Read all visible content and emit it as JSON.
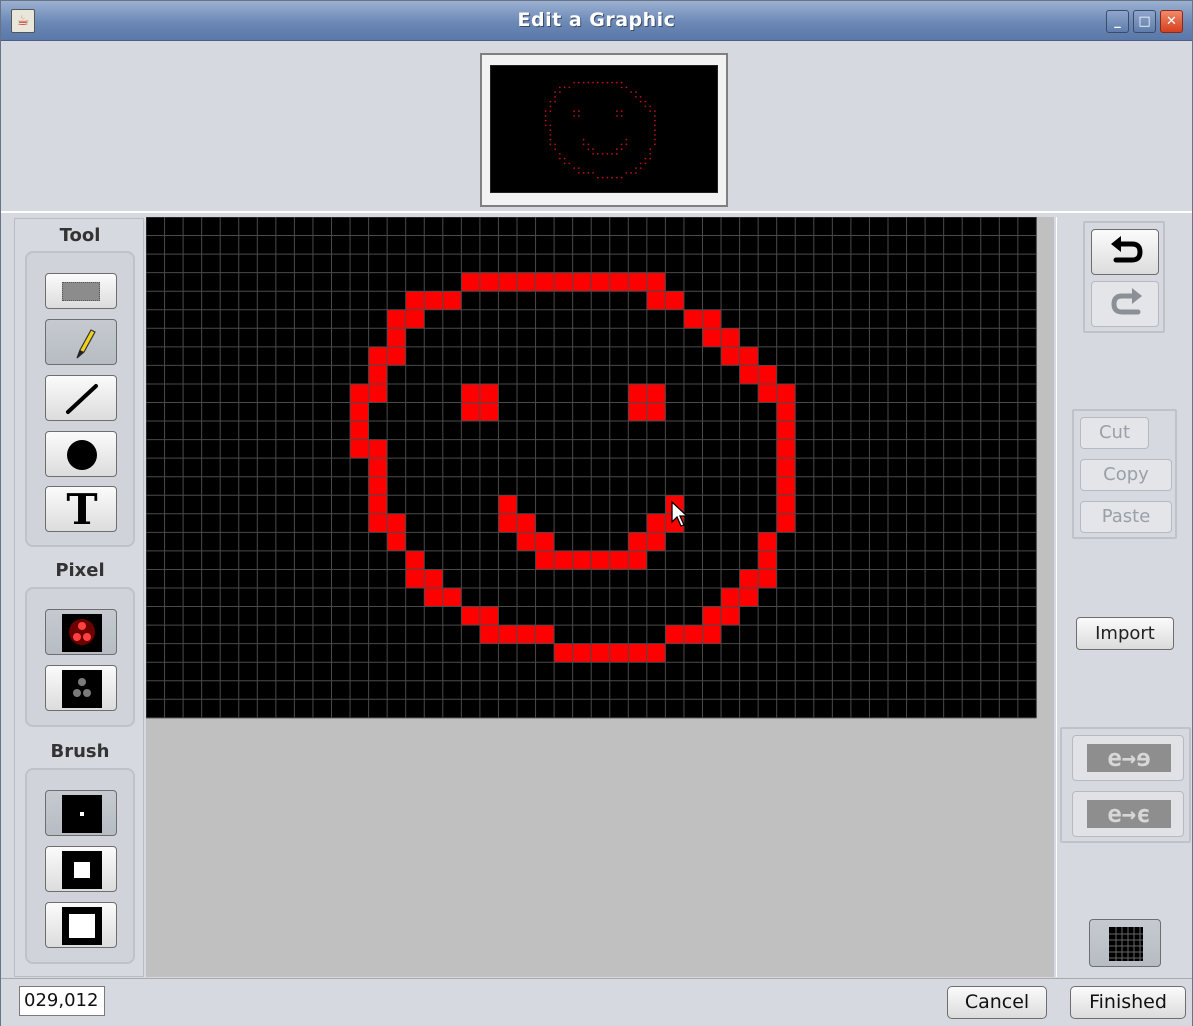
{
  "window": {
    "title": "Edit a Graphic",
    "controls": [
      "minimize",
      "maximize",
      "close"
    ]
  },
  "tool_panel": {
    "tool_label": "Tool",
    "tools": [
      {
        "name": "select",
        "icon": "marquee-select-icon",
        "selected": false
      },
      {
        "name": "pencil",
        "icon": "pencil-icon",
        "selected": true
      },
      {
        "name": "line",
        "icon": "line-icon",
        "selected": false
      },
      {
        "name": "circle",
        "icon": "filled-circle-icon",
        "selected": false
      },
      {
        "name": "text",
        "icon": "text-icon",
        "glyph": "T",
        "selected": false
      }
    ],
    "pixel_label": "Pixel",
    "pixels": [
      {
        "name": "red-pixel",
        "icon": "red-led-icon",
        "selected": true
      },
      {
        "name": "off-pixel",
        "icon": "dark-led-icon",
        "selected": false
      }
    ],
    "brush_label": "Brush",
    "brushes": [
      {
        "name": "small",
        "icon": "brush-small-icon",
        "selected": true
      },
      {
        "name": "medium",
        "icon": "brush-medium-icon",
        "selected": false
      },
      {
        "name": "large",
        "icon": "brush-large-icon",
        "selected": false
      }
    ]
  },
  "canvas": {
    "columns": 48,
    "rows": 27,
    "pixel_color": "#ff0000",
    "off_color": "#000000",
    "grid_color": "#4a4a4a",
    "lit_rows": [
      [
        3,
        [
          17,
          18,
          19,
          20,
          21,
          22,
          23,
          24,
          25,
          26,
          27
        ]
      ],
      [
        4,
        [
          14,
          15,
          16,
          27,
          28
        ]
      ],
      [
        5,
        [
          13,
          14,
          29,
          30
        ]
      ],
      [
        6,
        [
          13,
          30,
          31
        ]
      ],
      [
        7,
        [
          12,
          13,
          31,
          32
        ]
      ],
      [
        8,
        [
          12,
          32,
          33
        ]
      ],
      [
        9,
        [
          11,
          12,
          17,
          18,
          26,
          27,
          33,
          34
        ]
      ],
      [
        10,
        [
          11,
          17,
          18,
          26,
          27,
          34
        ]
      ],
      [
        11,
        [
          11,
          34
        ]
      ],
      [
        12,
        [
          11,
          12,
          34
        ]
      ],
      [
        13,
        [
          12,
          34
        ]
      ],
      [
        14,
        [
          12,
          34
        ]
      ],
      [
        15,
        [
          12,
          19,
          28,
          34
        ]
      ],
      [
        16,
        [
          12,
          13,
          19,
          20,
          27,
          28,
          34
        ]
      ],
      [
        17,
        [
          13,
          20,
          21,
          26,
          27,
          33
        ]
      ],
      [
        18,
        [
          14,
          21,
          22,
          23,
          24,
          25,
          26,
          33
        ]
      ],
      [
        19,
        [
          14,
          15,
          32,
          33
        ]
      ],
      [
        20,
        [
          15,
          16,
          31,
          32
        ]
      ],
      [
        21,
        [
          17,
          18,
          30,
          31
        ]
      ],
      [
        22,
        [
          18,
          19,
          20,
          21,
          28,
          29,
          30
        ]
      ],
      [
        23,
        [
          22,
          23,
          24,
          25,
          26,
          27
        ]
      ]
    ]
  },
  "right_panel": {
    "undo_icon": "undo-arrow-icon",
    "redo_icon": "redo-arrow-icon",
    "cut_label": "Cut",
    "copy_label": "Copy",
    "paste_label": "Paste",
    "import_label": "Import",
    "flip_horizontal_icon": "flip-horizontal-icon",
    "flip_vertical_icon": "flip-vertical-icon",
    "grid_toggle_icon": "grid-icon"
  },
  "status": {
    "coordinates": "029,012"
  },
  "footer": {
    "cancel_label": "Cancel",
    "finished_label": "Finished"
  }
}
